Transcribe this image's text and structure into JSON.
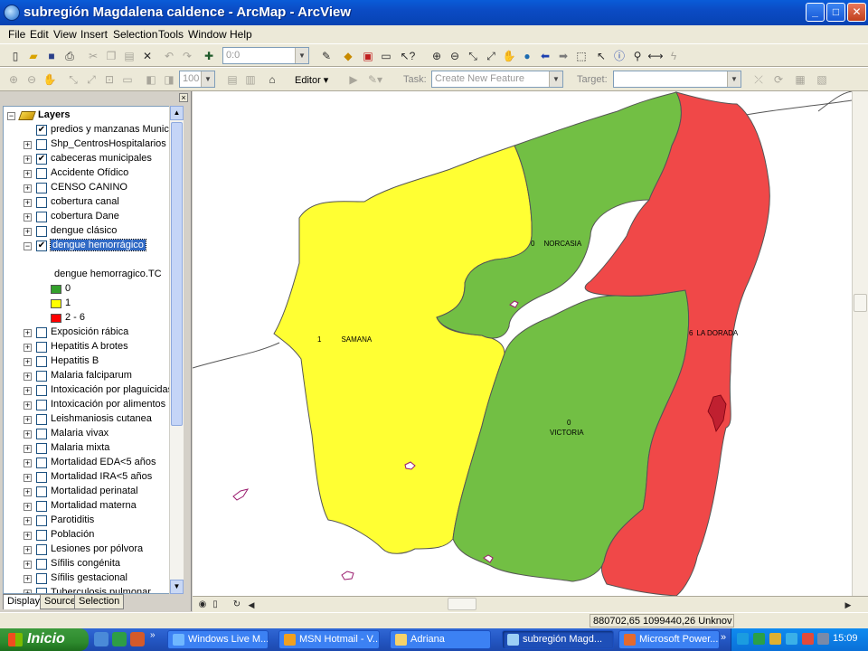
{
  "window": {
    "title": "subregión Magdalena caldence - ArcMap - ArcView",
    "minimize": "_",
    "maximize": "□",
    "close": "✕"
  },
  "menu": [
    "File",
    "Edit",
    "View",
    "Insert",
    "Selection",
    "Tools",
    "Window",
    "Help"
  ],
  "toolbar": {
    "scale_value": "0:0",
    "zoom_value": "100",
    "editor_label": "Editor ▾",
    "task_label": "Task:",
    "task_value": "Create New Feature",
    "target_label": "Target:"
  },
  "toc": {
    "root": "Layers",
    "layers": [
      {
        "label": "predios y manzanas Municip",
        "checked": true,
        "expand": ""
      },
      {
        "label": "Shp_CentrosHospitalarios",
        "checked": false,
        "expand": "+"
      },
      {
        "label": "cabeceras municipales",
        "checked": true,
        "expand": "+"
      },
      {
        "label": "Accidente Ofídico",
        "checked": false,
        "expand": "+"
      },
      {
        "label": "CENSO CANINO",
        "checked": false,
        "expand": "+"
      },
      {
        "label": "cobertura canal",
        "checked": false,
        "expand": "+"
      },
      {
        "label": "cobertura Dane",
        "checked": false,
        "expand": "+"
      },
      {
        "label": "dengue clásico",
        "checked": false,
        "expand": "+"
      },
      {
        "label": "dengue hemorrágico",
        "checked": true,
        "expand": "−",
        "selected": true
      }
    ],
    "legend_field": "dengue hemorragico.TC",
    "legend": [
      {
        "label": "0",
        "color": "#33a02c"
      },
      {
        "label": "1",
        "color": "#ffff00"
      },
      {
        "label": "2 - 6",
        "color": "#ff0000"
      }
    ],
    "layers2": [
      "Exposición rábica",
      "Hepatitis A brotes",
      "Hepatitis B",
      "Malaria falciparum",
      "Intoxicación por plaguicidas",
      "Intoxicación por alimentos",
      "Leishmaniosis cutanea",
      "Malaria vivax",
      "Malaria mixta",
      "Mortalidad EDA<5 años",
      "Mortalidad IRA<5 años",
      "Mortalidad perinatal",
      "Mortalidad materna",
      "Parotiditis",
      "Población",
      "Lesiones por pólvora",
      "Sífilis congénita",
      "Sífilis gestacional",
      "Tuberculosis pulmonar"
    ],
    "tabs": [
      "Display",
      "Source",
      "Selection"
    ]
  },
  "map": {
    "labels": [
      {
        "value": "0",
        "name": "NORCASIA"
      },
      {
        "value": "1",
        "name": "SAMANA"
      },
      {
        "value": "6",
        "name": "LA DORADA"
      },
      {
        "value": "0",
        "name": "VICTORIA"
      }
    ],
    "colors": {
      "zero": "#72bf44",
      "one": "#ffff33",
      "high": "#f04848",
      "outline": "#444444"
    }
  },
  "status": {
    "coords": "880702,65  1099440,26 Unknov"
  },
  "taskbar": {
    "start": "Inicio",
    "tasks": [
      "Windows Live M...",
      "MSN Hotmail - V...",
      "Adriana",
      "subregión Magd...",
      "Microsoft Power..."
    ],
    "clock": "15:09"
  }
}
